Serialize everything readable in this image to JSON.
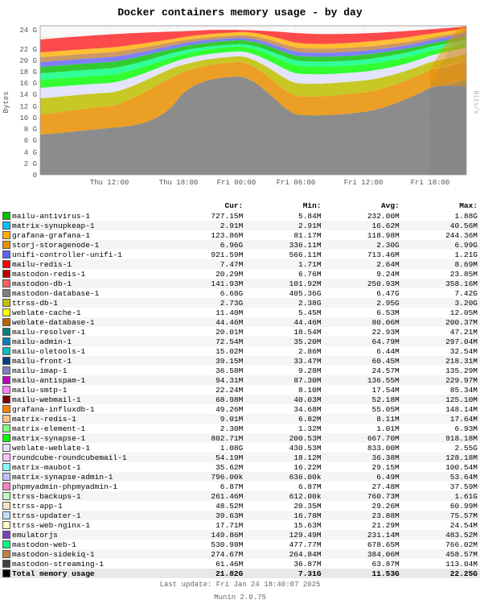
{
  "title": "Docker containers memory usage - by day",
  "chart": {
    "y_axis_label": "Bytes",
    "right_label": "Bits/s",
    "x_labels": [
      "Thu 12:00",
      "Thu 18:00",
      "Fri 00:00",
      "Fri 06:00",
      "Fri 12:00",
      "Fri 18:00"
    ],
    "y_labels": [
      "0",
      "2 G",
      "4 G",
      "6 G",
      "8 G",
      "10 G",
      "12 G",
      "14 G",
      "16 G",
      "18 G",
      "20 G",
      "22 G",
      "24 G"
    ]
  },
  "header": {
    "cur": "Cur:",
    "min": "Min:",
    "avg": "Avg:",
    "max": "Max:"
  },
  "legend": [
    {
      "color": "#00c000",
      "name": "mailu-antivirus-1",
      "cur": "727.15M",
      "min": "5.84M",
      "avg": "232.00M",
      "max": "1.88G"
    },
    {
      "color": "#00c0ff",
      "name": "matrix-synupkeap-1",
      "cur": "2.91M",
      "min": "2.91M",
      "avg": "16.62M",
      "max": "40.56M"
    },
    {
      "color": "#ffb000",
      "name": "grafana-grafana-1",
      "cur": "123.86M",
      "min": "81.17M",
      "avg": "118.98M",
      "max": "244.36M"
    },
    {
      "color": "#ea8f00",
      "name": "storj-storagenode-1",
      "cur": "6.96G",
      "min": "336.11M",
      "avg": "2.30G",
      "max": "6.99G"
    },
    {
      "color": "#6060ff",
      "name": "unifi-controller-unifi-1",
      "cur": "921.59M",
      "min": "566.11M",
      "avg": "713.46M",
      "max": "1.21G"
    },
    {
      "color": "#ff0000",
      "name": "mailu-redis-1",
      "cur": "7.47M",
      "min": "1.71M",
      "avg": "2.64M",
      "max": "8.69M"
    },
    {
      "color": "#c00000",
      "name": "mastodon-redis-1",
      "cur": "20.29M",
      "min": "6.76M",
      "avg": "9.24M",
      "max": "23.85M"
    },
    {
      "color": "#ff6060",
      "name": "mastodon-db-1",
      "cur": "141.93M",
      "min": "101.92M",
      "avg": "250.93M",
      "max": "358.16M"
    },
    {
      "color": "#808080",
      "name": "mastodon-database-1",
      "cur": "6.68G",
      "min": "405.36G",
      "avg": "6.47G",
      "max": "7.42G"
    },
    {
      "color": "#c0c000",
      "name": "ttrss-db-1",
      "cur": "2.73G",
      "min": "2.38G",
      "avg": "2.95G",
      "max": "3.20G"
    },
    {
      "color": "#ffff00",
      "name": "weblate-cache-1",
      "cur": "11.40M",
      "min": "5.45M",
      "avg": "6.53M",
      "max": "12.05M"
    },
    {
      "color": "#c06000",
      "name": "weblate-database-1",
      "cur": "44.46M",
      "min": "44.46M",
      "avg": "80.06M",
      "max": "200.37M"
    },
    {
      "color": "#008080",
      "name": "mailu-resolver-1",
      "cur": "20.01M",
      "min": "18.54M",
      "avg": "22.93M",
      "max": "47.21M"
    },
    {
      "color": "#0080c0",
      "name": "mailu-admin-1",
      "cur": "72.54M",
      "min": "35.20M",
      "avg": "64.79M",
      "max": "297.04M"
    },
    {
      "color": "#00c0c0",
      "name": "mailu-oletools-1",
      "cur": "15.02M",
      "min": "2.86M",
      "avg": "6.44M",
      "max": "32.54M"
    },
    {
      "color": "#004080",
      "name": "mailu-front-1",
      "cur": "39.15M",
      "min": "33.47M",
      "avg": "60.45M",
      "max": "218.31M"
    },
    {
      "color": "#8080c0",
      "name": "mailu-imap-1",
      "cur": "36.58M",
      "min": "9.28M",
      "avg": "24.57M",
      "max": "135.29M"
    },
    {
      "color": "#c000c0",
      "name": "mailu-antispam-1",
      "cur": "94.31M",
      "min": "87.30M",
      "avg": "136.55M",
      "max": "229.97M"
    },
    {
      "color": "#ff80ff",
      "name": "mailu-smtp-1",
      "cur": "22.24M",
      "min": "8.10M",
      "avg": "17.54M",
      "max": "85.34M"
    },
    {
      "color": "#800000",
      "name": "mailu-webmail-1",
      "cur": "68.98M",
      "min": "40.03M",
      "avg": "52.18M",
      "max": "125.10M"
    },
    {
      "color": "#ff8000",
      "name": "grafana-influxdb-1",
      "cur": "49.26M",
      "min": "34.68M",
      "avg": "55.05M",
      "max": "148.14M"
    },
    {
      "color": "#ffc080",
      "name": "matrix-redis-1",
      "cur": "9.01M",
      "min": "6.82M",
      "avg": "8.11M",
      "max": "17.64M"
    },
    {
      "color": "#80ff80",
      "name": "matrix-element-1",
      "cur": "2.30M",
      "min": "1.32M",
      "avg": "1.01M",
      "max": "6.93M"
    },
    {
      "color": "#00ff00",
      "name": "matrix-synapse-1",
      "cur": "802.71M",
      "min": "200.53M",
      "avg": "667.70M",
      "max": "918.18M"
    },
    {
      "color": "#e0e0ff",
      "name": "weblate-weblate-1",
      "cur": "1.08G",
      "min": "430.53M",
      "avg": "833.00M",
      "max": "2.55G"
    },
    {
      "color": "#ffc0ff",
      "name": "roundcube-roundcubemail-1",
      "cur": "54.19M",
      "min": "18.12M",
      "avg": "36.38M",
      "max": "128.18M"
    },
    {
      "color": "#80ffff",
      "name": "matrix-maubot-1",
      "cur": "35.62M",
      "min": "16.22M",
      "avg": "29.15M",
      "max": "100.54M"
    },
    {
      "color": "#c0c0ff",
      "name": "matrix-synapse-admin-1",
      "cur": "796.00k",
      "min": "636.00k",
      "avg": "6.49M",
      "max": "53.64M"
    },
    {
      "color": "#ff80c0",
      "name": "phpmyadmin-phpmyadmin-1",
      "cur": "6.87M",
      "min": "6.87M",
      "avg": "27.48M",
      "max": "37.59M"
    },
    {
      "color": "#c0ffc0",
      "name": "ttrss-backups-1",
      "cur": "261.46M",
      "min": "612.00k",
      "avg": "760.73M",
      "max": "1.61G"
    },
    {
      "color": "#ffe0c0",
      "name": "ttrss-app-1",
      "cur": "48.52M",
      "min": "20.35M",
      "avg": "29.26M",
      "max": "60.99M"
    },
    {
      "color": "#c0e0ff",
      "name": "ttrss-updater-1",
      "cur": "39.63M",
      "min": "16.78M",
      "avg": "23.88M",
      "max": "75.57M"
    },
    {
      "color": "#ffffc0",
      "name": "ttrss-web-nginx-1",
      "cur": "17.71M",
      "min": "15.63M",
      "avg": "21.29M",
      "max": "24.54M"
    },
    {
      "color": "#8040c0",
      "name": "emulatorjs",
      "cur": "149.86M",
      "min": "129.49M",
      "avg": "231.14M",
      "max": "483.52M"
    },
    {
      "color": "#00ff80",
      "name": "mastodon-web-1",
      "cur": "530.98M",
      "min": "477.77M",
      "avg": "678.65M",
      "max": "766.02M"
    },
    {
      "color": "#c08040",
      "name": "mastodon-sidekiq-1",
      "cur": "274.67M",
      "min": "264.84M",
      "avg": "384.06M",
      "max": "458.57M"
    },
    {
      "color": "#404040",
      "name": "mastodon-streaming-1",
      "cur": "61.46M",
      "min": "36.87M",
      "avg": "63.87M",
      "max": "113.04M"
    },
    {
      "color": "#000000",
      "name": "Total memory usage",
      "cur": "21.82G",
      "min": "7.31G",
      "avg": "11.53G",
      "max": "22.25G"
    }
  ],
  "footer": {
    "munin_version": "Munin 2.0.75",
    "last_update": "Last update: Fri Jan 24 18:40:07 2025"
  }
}
